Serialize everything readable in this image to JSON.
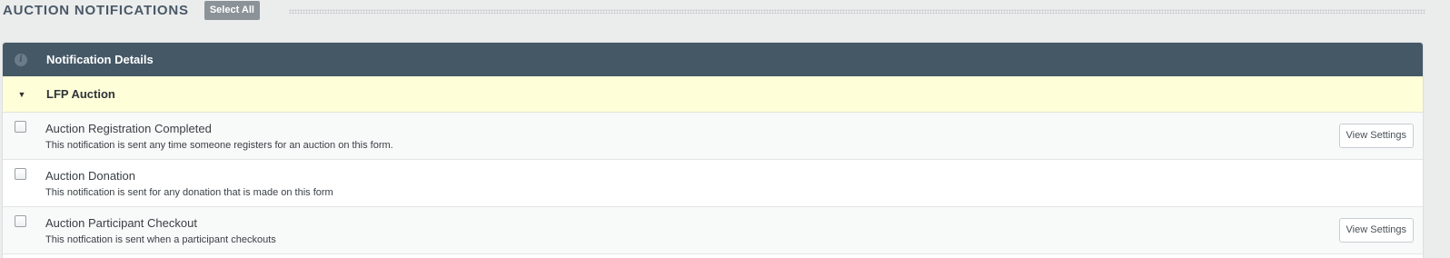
{
  "section": {
    "title": "AUCTION NOTIFICATIONS",
    "select_all_label": "Select All"
  },
  "panel": {
    "header_title": "Notification Details",
    "info_icon": "info-icon",
    "group": {
      "label": "LFP Auction",
      "expanded": true,
      "caret_glyph": "▼"
    },
    "notifications": [
      {
        "title": "Auction Registration Completed",
        "description": "This notification is sent any time someone registers for an auction on this form.",
        "checked": false,
        "action_label": "View Settings"
      },
      {
        "title": "Auction Donation",
        "description": "This notification is sent for any donation that is made on this form",
        "checked": false,
        "action_label": ""
      },
      {
        "title": "Auction Participant Checkout",
        "description": "This notfication is sent when a participant checkouts",
        "checked": false,
        "action_label": "View Settings"
      }
    ]
  },
  "colors": {
    "header_bg": "#455866",
    "group_bg": "#fefed9",
    "page_bg": "#ebeded",
    "select_all_bg": "#8b9399"
  }
}
